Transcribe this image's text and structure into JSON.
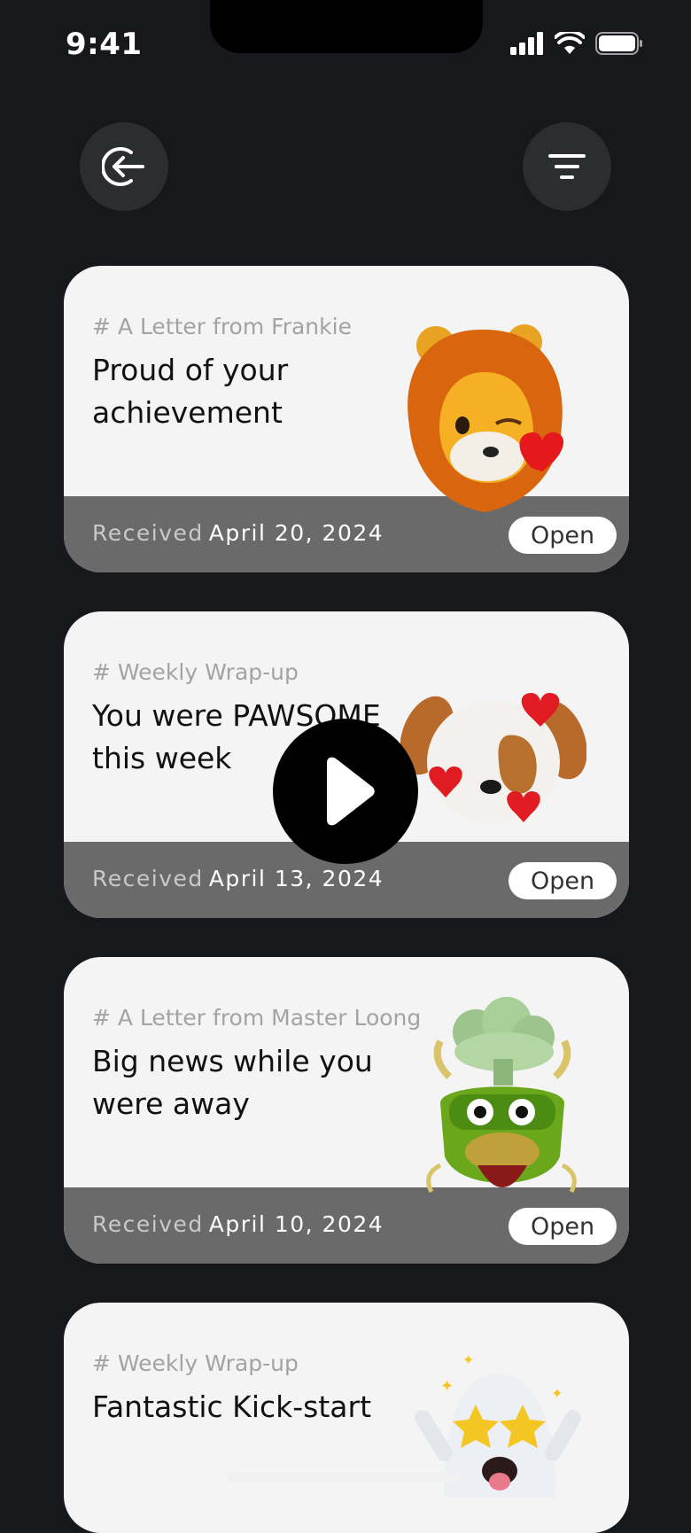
{
  "status_bar": {
    "time": "9:41"
  },
  "header": {
    "back_icon": "circle-arrow-left-icon",
    "filter_icon": "filter-lines-icon"
  },
  "letters": [
    {
      "tag": "# A Letter from Frankie",
      "title": "Proud of your achievement",
      "received_label": "Received",
      "date": "April 20, 2024",
      "open_label": "Open",
      "art": "lion-emoji-with-heart"
    },
    {
      "tag": "# Weekly Wrap-up",
      "title": "You were PAWSOME this week",
      "received_label": "Received",
      "date": "April 13, 2024",
      "open_label": "Open",
      "art": "dog-emoji-with-hearts"
    },
    {
      "tag": "# A Letter from Master Loong",
      "title": "Big news while you were away",
      "received_label": "Received",
      "date": "April 10, 2024",
      "open_label": "Open",
      "art": "dragon-emoji-mind-blown"
    },
    {
      "tag": "# Weekly Wrap-up",
      "title": "Fantastic Kick-start",
      "art": "ghost-emoji-star-eyes"
    }
  ],
  "overlay": {
    "play_icon": "play-icon"
  },
  "colors": {
    "background": "#17181c",
    "card": "#f4f4f4",
    "card_footer": "#6a6a6a",
    "button": "#2c2d31"
  }
}
